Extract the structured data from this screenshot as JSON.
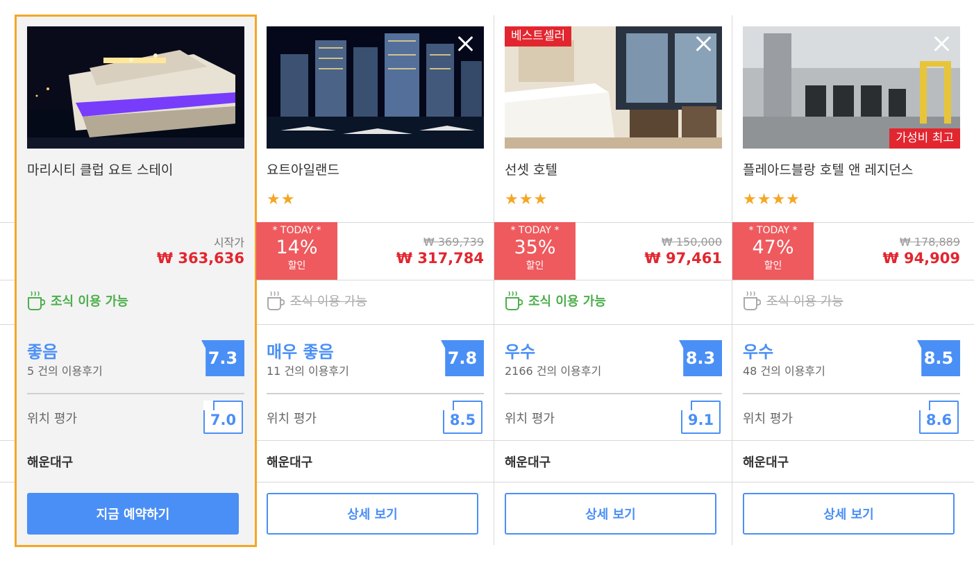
{
  "hotels": [
    {
      "name": "마리시티 클럽 요트 스테이",
      "stars": "",
      "start_label": "시작가",
      "price": "₩ 363,636",
      "breakfast": "조식 이용 가능",
      "rating_word": "좋음",
      "reviews": "5 건의 이용후기",
      "score": "7.3",
      "location_label": "위치 평가",
      "location_score": "7.0",
      "district": "해운대구",
      "button_label": "지금 예약하기"
    },
    {
      "name": "요트아일랜드",
      "stars": "★★",
      "today_label": "* TODAY *",
      "discount_pct": "14%",
      "discount_word": "할인",
      "original_price": "₩ 369,739",
      "price": "₩ 317,784",
      "breakfast": "조식 이용 가능",
      "rating_word": "매우 좋음",
      "reviews": "11 건의 이용후기",
      "score": "7.8",
      "location_label": "위치 평가",
      "location_score": "8.5",
      "district": "해운대구",
      "button_label": "상세 보기"
    },
    {
      "name": "선셋 호텔",
      "badge": "베스트셀러",
      "stars": "★★★",
      "today_label": "* TODAY *",
      "discount_pct": "35%",
      "discount_word": "할인",
      "original_price": "₩ 150,000",
      "price": "₩ 97,461",
      "breakfast": "조식 이용 가능",
      "rating_word": "우수",
      "reviews": "2166 건의 이용후기",
      "score": "8.3",
      "location_label": "위치 평가",
      "location_score": "9.1",
      "district": "해운대구",
      "button_label": "상세 보기"
    },
    {
      "name": "플레아드블랑 호텔 앤 레지던스",
      "badge": "가성비 최고",
      "stars": "★★★★",
      "today_label": "* TODAY *",
      "discount_pct": "47%",
      "discount_word": "할인",
      "original_price": "₩ 178,889",
      "price": "₩ 94,909",
      "breakfast": "조식 이용 가능",
      "rating_word": "우수",
      "reviews": "48 건의 이용후기",
      "score": "8.5",
      "location_label": "위치 평가",
      "location_score": "8.6",
      "district": "해운대구",
      "button_label": "상세 보기"
    }
  ],
  "colors": {
    "accent_blue": "#4a8ff5",
    "price_red": "#e2262f",
    "today_red": "#ee5a5e",
    "star_orange": "#f5a623",
    "breakfast_green": "#4cae4c",
    "highlight_border": "#f5a623"
  }
}
